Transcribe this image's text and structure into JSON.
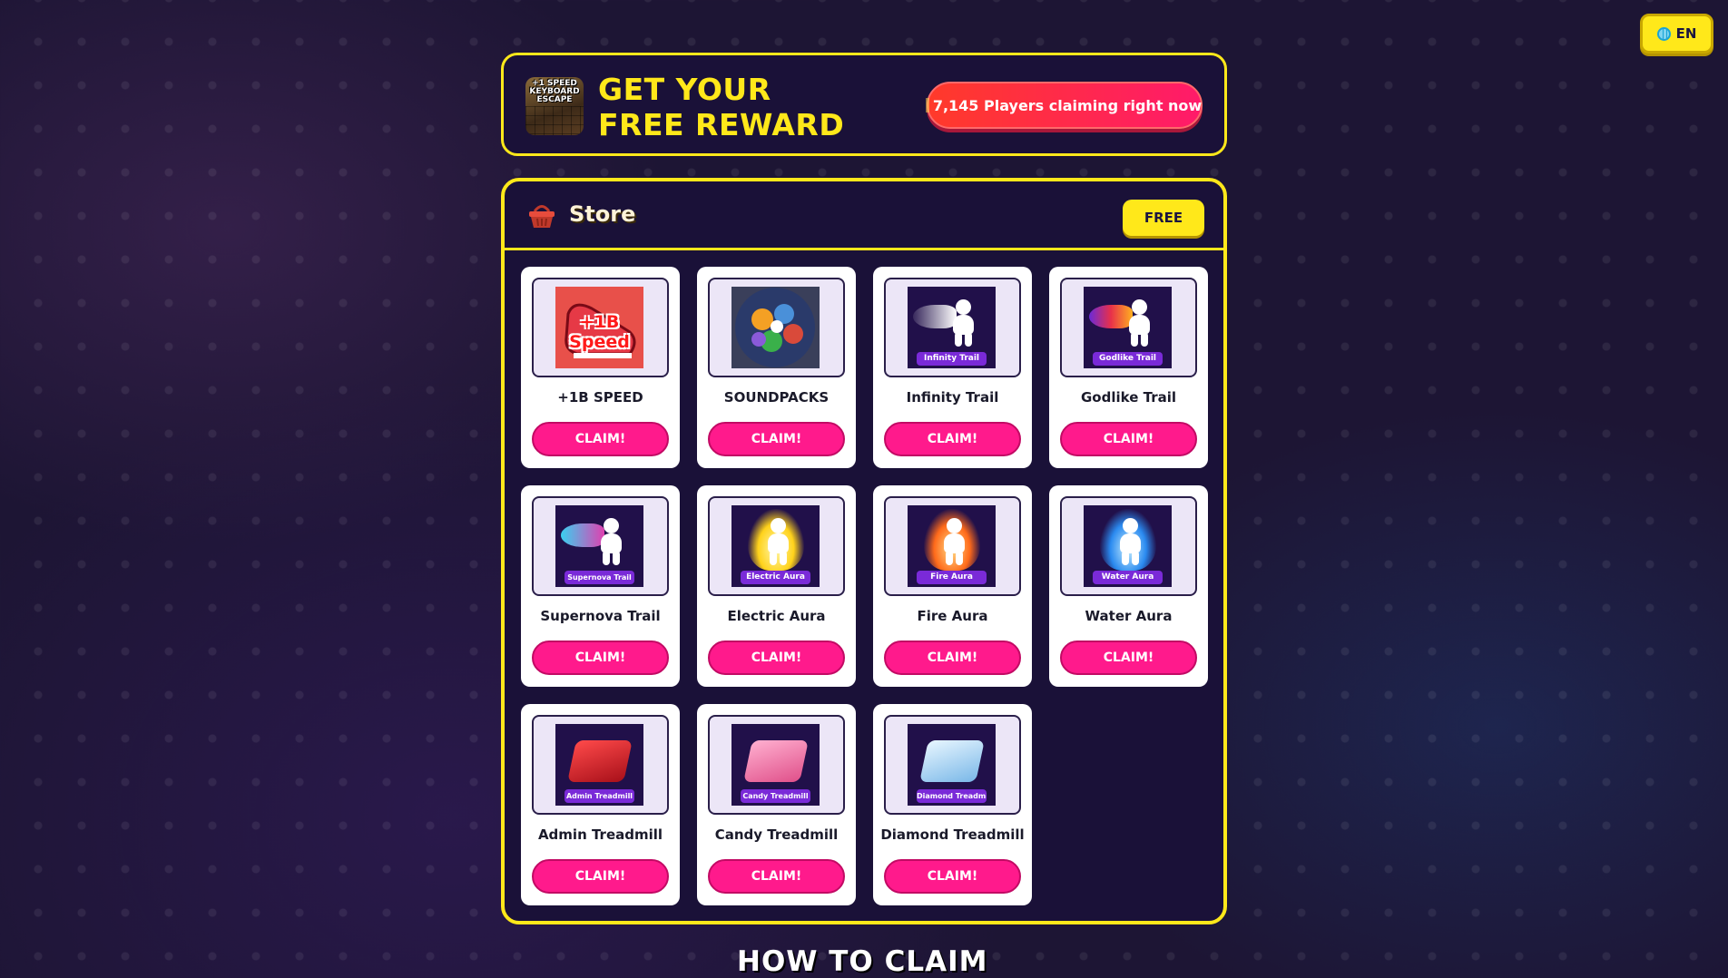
{
  "language_button": {
    "label": "EN",
    "icon": "globe-icon"
  },
  "header": {
    "game_icon_text": "+1 SPEED KEYBOARD ESCAPE",
    "title": "GET YOUR FREE REWARD",
    "players_pill": "7,145 Players claiming right now"
  },
  "store": {
    "title": "Store",
    "icon": "basket-icon",
    "free_label": "FREE",
    "items": [
      {
        "name": "+1B SPEED",
        "thumb_label": "+1B Speed",
        "claim": "CLAIM!"
      },
      {
        "name": "SOUNDPACKS",
        "thumb_label": "",
        "claim": "CLAIM!"
      },
      {
        "name": "Infinity Trail",
        "thumb_label": "Infinity Trail",
        "claim": "CLAIM!"
      },
      {
        "name": "Godlike Trail",
        "thumb_label": "Godlike Trail",
        "claim": "CLAIM!"
      },
      {
        "name": "Supernova Trail",
        "thumb_label": "Supernova Trail",
        "claim": "CLAIM!"
      },
      {
        "name": "Electric Aura",
        "thumb_label": "Electric Aura",
        "claim": "CLAIM!"
      },
      {
        "name": "Fire Aura",
        "thumb_label": "Fire Aura",
        "claim": "CLAIM!"
      },
      {
        "name": "Water Aura",
        "thumb_label": "Water Aura",
        "claim": "CLAIM!"
      },
      {
        "name": "Admin Treadmill",
        "thumb_label": "Admin Treadmill",
        "claim": "CLAIM!"
      },
      {
        "name": "Candy Treadmill",
        "thumb_label": "Candy Treadmill",
        "claim": "CLAIM!"
      },
      {
        "name": "Diamond Treadmill",
        "thumb_label": "Diamond Treadmill",
        "claim": "CLAIM!"
      }
    ]
  },
  "how_to_claim": {
    "title": "HOW TO CLAIM",
    "icon": "question-mark-icon"
  },
  "colors": {
    "accent_yellow": "#ffe81a",
    "claim_pink": "#ff1a8c",
    "background": "#1d1534",
    "panel": "#1a1138"
  }
}
